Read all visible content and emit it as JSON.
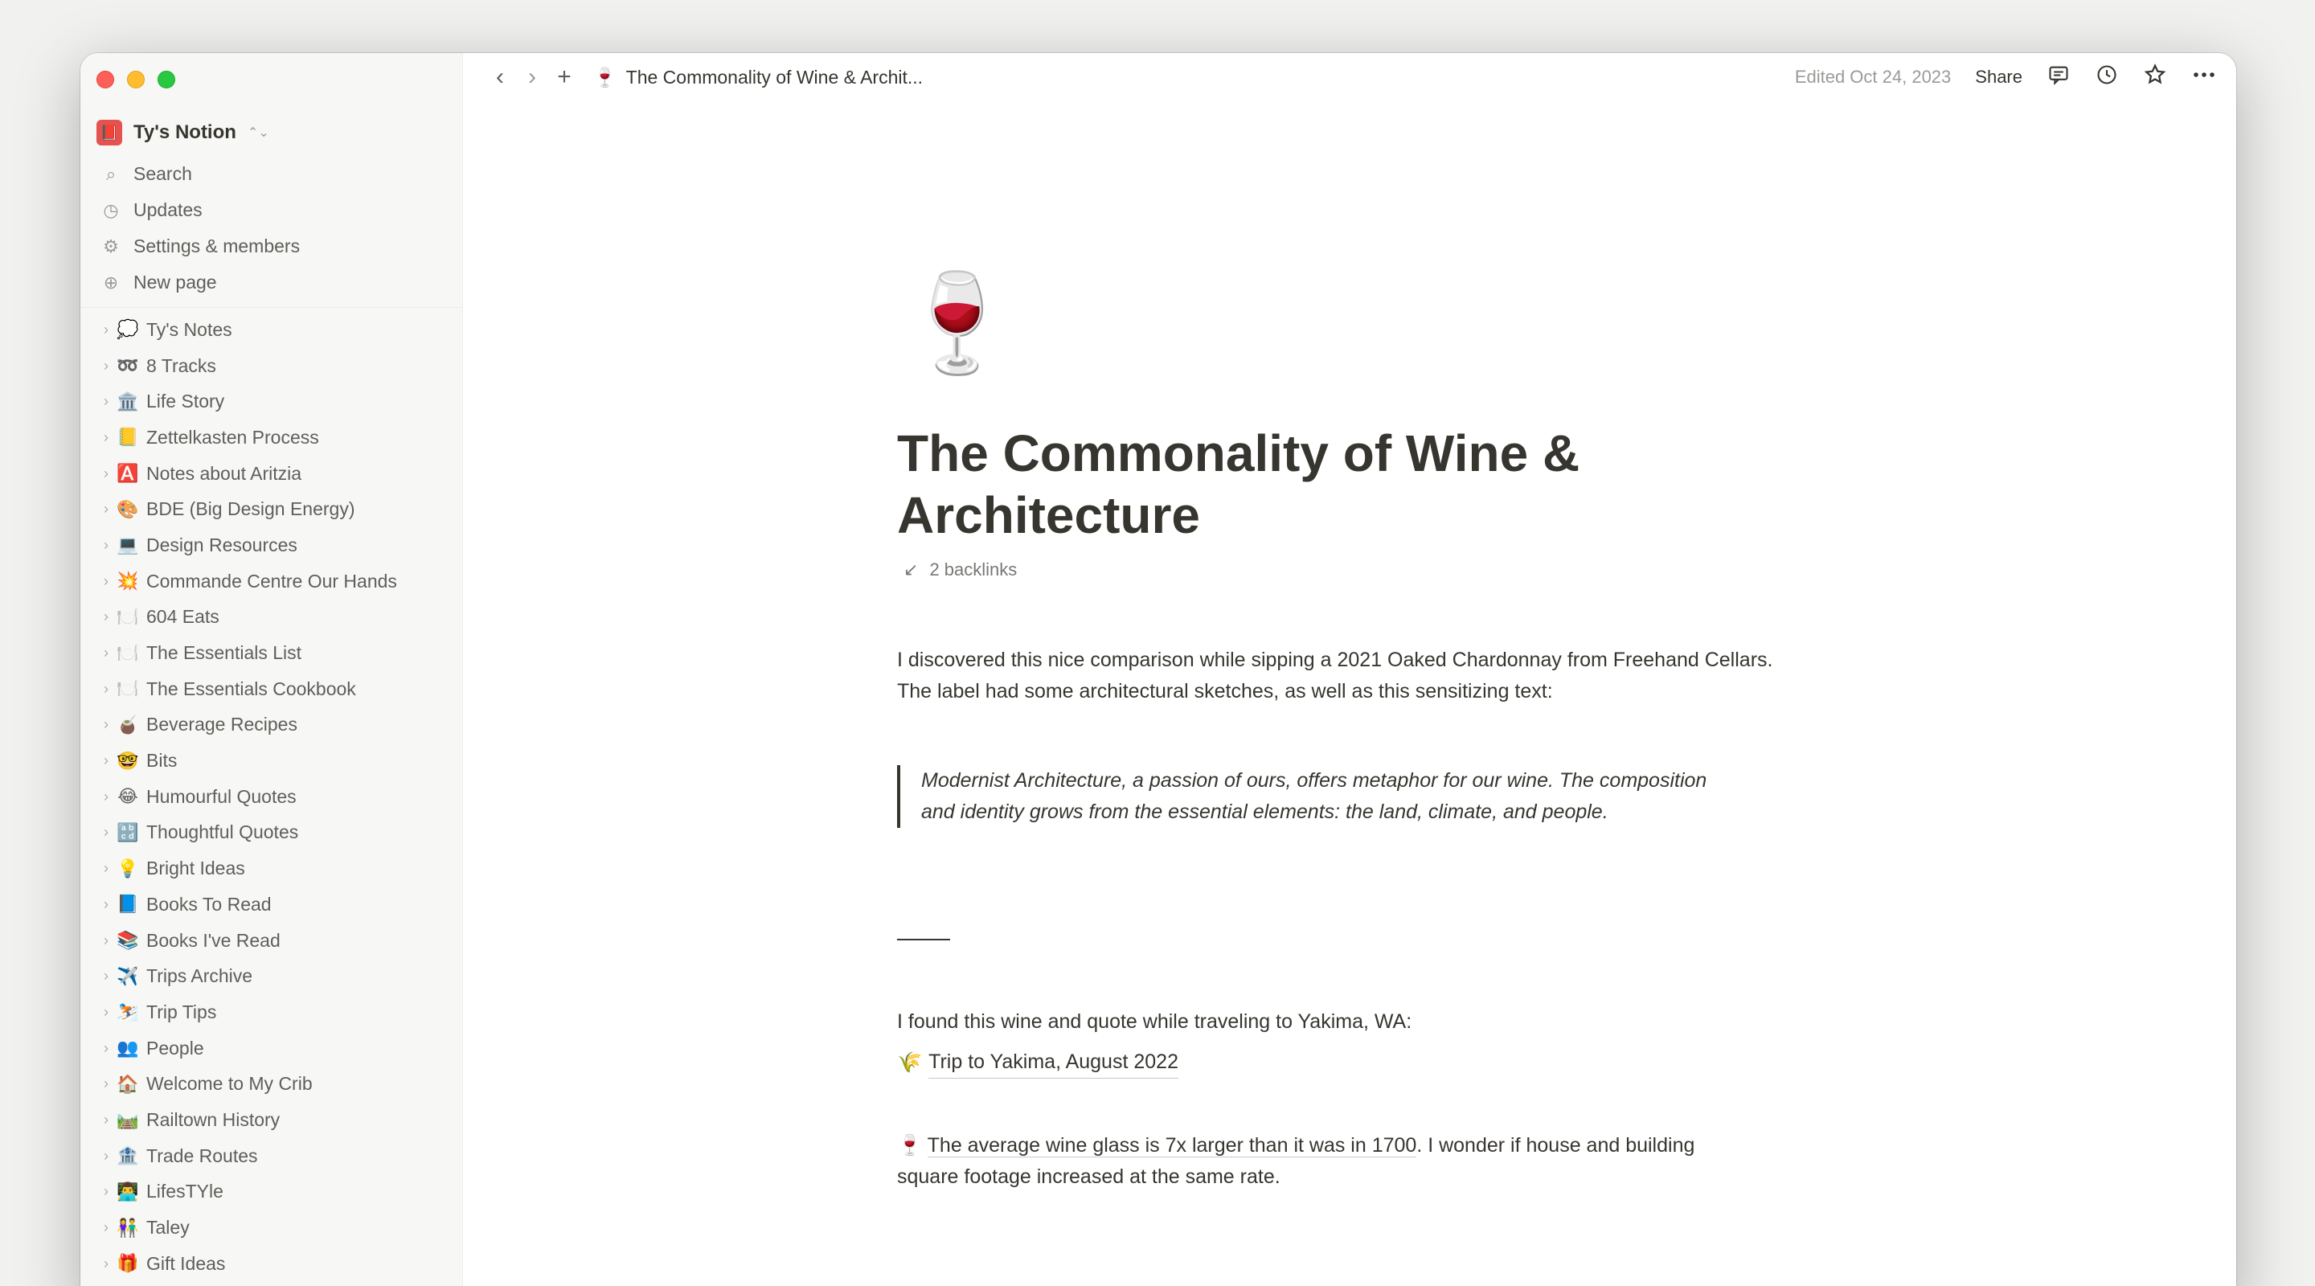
{
  "workspace": {
    "name": "Ty's Notion",
    "avatar_icon": "📕",
    "caret": "⌃⌄"
  },
  "nav": [
    {
      "icon": "search-icon",
      "glyph": "⌕",
      "label": "Search"
    },
    {
      "icon": "clock-icon",
      "glyph": "◷",
      "label": "Updates"
    },
    {
      "icon": "gear-icon",
      "glyph": "⚙",
      "label": "Settings & members"
    },
    {
      "icon": "plus-circle-icon",
      "glyph": "⊕",
      "label": "New page"
    }
  ],
  "pages": [
    {
      "emoji": "💭",
      "label": "Ty's Notes"
    },
    {
      "emoji": "➿",
      "label": "8 Tracks"
    },
    {
      "emoji": "🏛️",
      "label": "Life Story"
    },
    {
      "emoji": "📒",
      "label": "Zettelkasten Process"
    },
    {
      "emoji": "🅰️",
      "label": "Notes about Aritzia"
    },
    {
      "emoji": "🎨",
      "label": "BDE (Big Design Energy)"
    },
    {
      "emoji": "💻",
      "label": "Design Resources"
    },
    {
      "emoji": "💥",
      "label": "Commande Centre Our Hands"
    },
    {
      "emoji": "🍽️",
      "label": "604 Eats"
    },
    {
      "emoji": "🍽️",
      "label": "The Essentials List"
    },
    {
      "emoji": "🍽️",
      "label": "The Essentials Cookbook"
    },
    {
      "emoji": "🧉",
      "label": "Beverage Recipes"
    },
    {
      "emoji": "🤓",
      "label": "Bits"
    },
    {
      "emoji": "😂",
      "label": "Humourful Quotes"
    },
    {
      "emoji": "🔡",
      "label": "Thoughtful Quotes"
    },
    {
      "emoji": "💡",
      "label": "Bright Ideas"
    },
    {
      "emoji": "📘",
      "label": "Books To Read"
    },
    {
      "emoji": "📚",
      "label": "Books I've Read"
    },
    {
      "emoji": "✈️",
      "label": "Trips Archive"
    },
    {
      "emoji": "⛷️",
      "label": "Trip Tips"
    },
    {
      "emoji": "👥",
      "label": "People"
    },
    {
      "emoji": "🏠",
      "label": "Welcome to My Crib"
    },
    {
      "emoji": "🛤️",
      "label": "Railtown History"
    },
    {
      "emoji": "🏦",
      "label": "Trade Routes"
    },
    {
      "emoji": "👨‍💻",
      "label": "LifesTYle"
    },
    {
      "emoji": "👫",
      "label": "Taley"
    },
    {
      "emoji": "🎁",
      "label": "Gift Ideas"
    }
  ],
  "topbar": {
    "back": "‹",
    "forward": "›",
    "add": "+",
    "crumb_emoji": "🍷",
    "crumb_title": "The Commonality of Wine & Archit...",
    "edited": "Edited Oct 24, 2023",
    "share": "Share",
    "comment_glyph": "💬",
    "history_glyph": "◷",
    "star_glyph": "☆",
    "more_glyph": "•••"
  },
  "page": {
    "emoji": "🍷",
    "title": "The Commonality of Wine & Architecture",
    "backlinks_glyph": "↙",
    "backlinks": "2 backlinks",
    "para1_line1": "I discovered this nice comparison while sipping a 2021 Oaked Chardonnay from Freehand Cellars.",
    "para1_line2": "The label had some architectural sketches, as well as this sensitizing text:",
    "quote_line1": "Modernist Architecture, a passion of ours, offers metaphor for our wine. The composition",
    "quote_line2": "and identity grows from the essential elements: the land, climate, and people.",
    "para2": "I found this wine and quote while traveling to Yakima, WA:",
    "trip_emoji": "🌾",
    "trip_link": "Trip to Yakima, August 2022",
    "fact_emoji": "🍷",
    "fact_link": "The average wine glass is 7x larger than it was in 1700",
    "fact_rest": ". I wonder if house and building",
    "fact_line2": "square footage increased at the same rate."
  }
}
